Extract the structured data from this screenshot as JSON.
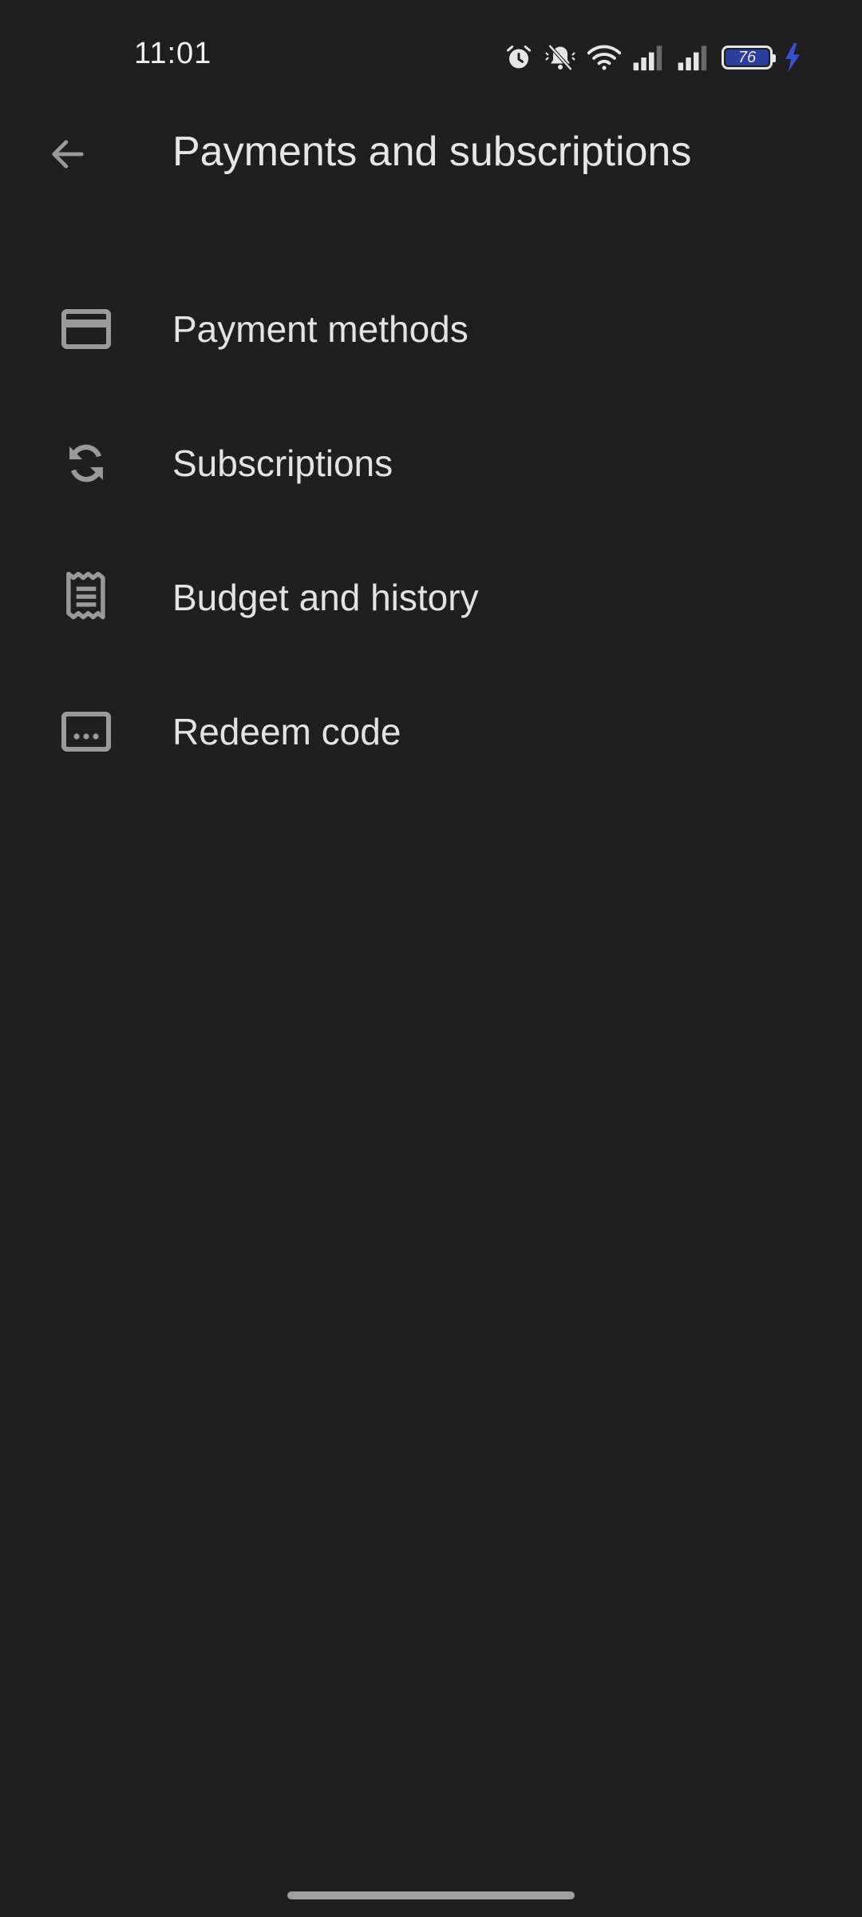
{
  "status_bar": {
    "time": "11:01",
    "battery_level": "76",
    "icons": [
      "alarm-icon",
      "bell-muted-icon",
      "wifi-icon",
      "signal-icon",
      "signal-icon",
      "battery-icon",
      "charging-bolt-icon"
    ],
    "battery_fill_color": "#2c3d9e",
    "charging_color": "#3a4fd6"
  },
  "app_bar": {
    "title": "Payments and subscriptions",
    "back_icon": "arrow-back-icon"
  },
  "menu": {
    "items": [
      {
        "label": "Payment methods",
        "icon": "credit-card-icon"
      },
      {
        "label": "Subscriptions",
        "icon": "sync-icon"
      },
      {
        "label": "Budget and history",
        "icon": "receipt-icon"
      },
      {
        "label": "Redeem code",
        "icon": "redeem-code-icon"
      }
    ]
  },
  "colors": {
    "background": "#1f1f1f",
    "text_primary": "#e3e3e3",
    "icon": "#9a9a9a"
  }
}
